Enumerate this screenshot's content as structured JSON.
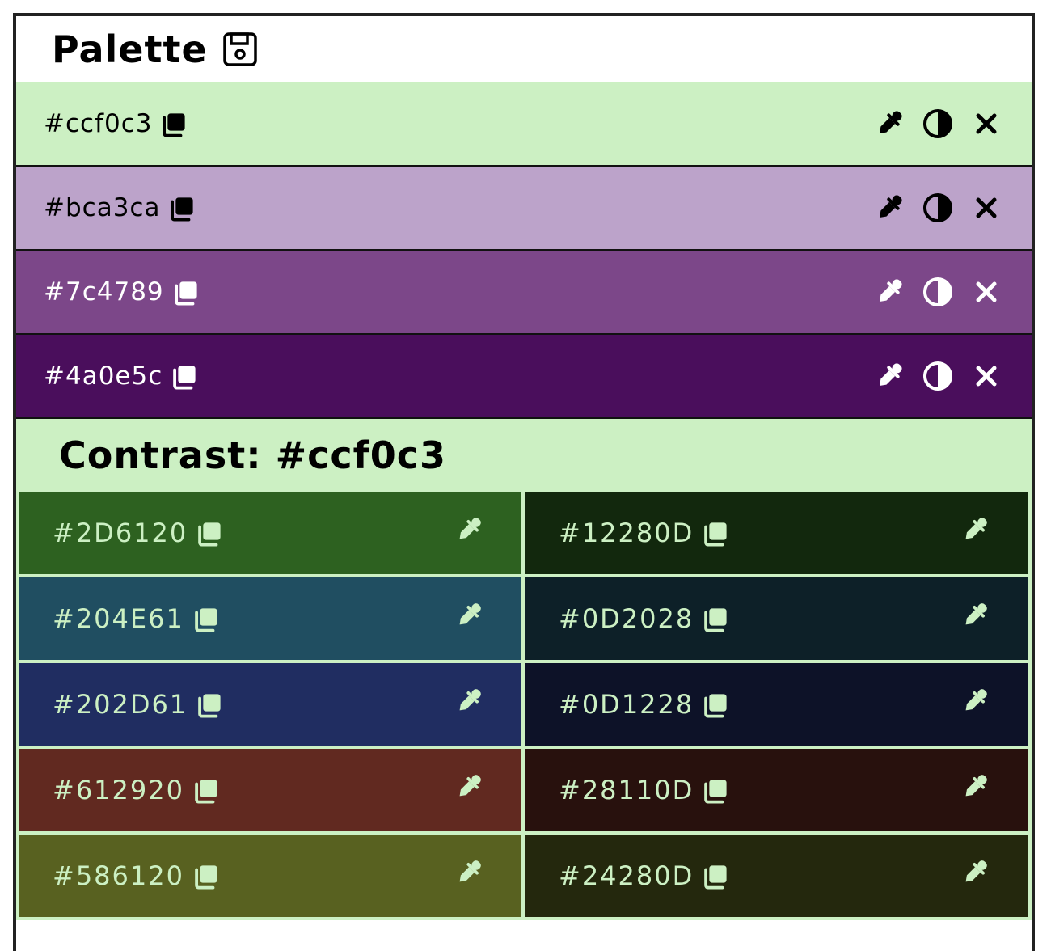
{
  "header": {
    "title": "Palette",
    "save_icon": "floppy-disk-icon"
  },
  "palette": [
    {
      "hex": "#ccf0c3",
      "bg": "#ccf0c3",
      "fg": "#000000"
    },
    {
      "hex": "#bca3ca",
      "bg": "#bca3ca",
      "fg": "#000000"
    },
    {
      "hex": "#7c4789",
      "bg": "#7c4789",
      "fg": "#ffffff"
    },
    {
      "hex": "#4a0e5c",
      "bg": "#4a0e5c",
      "fg": "#ffffff"
    }
  ],
  "row_icons": {
    "copy": "copy-icon",
    "pick": "eyedropper-icon",
    "contrast": "contrast-icon",
    "remove": "close-icon"
  },
  "contrast": {
    "title": "Contrast: #ccf0c3",
    "accent": "#ccf0c3",
    "cells": [
      {
        "hex": "#2D6120",
        "bg": "#2D6120"
      },
      {
        "hex": "#12280D",
        "bg": "#12280D"
      },
      {
        "hex": "#204E61",
        "bg": "#204E61"
      },
      {
        "hex": "#0D2028",
        "bg": "#0D2028"
      },
      {
        "hex": "#202D61",
        "bg": "#202D61"
      },
      {
        "hex": "#0D1228",
        "bg": "#0D1228"
      },
      {
        "hex": "#612920",
        "bg": "#612920"
      },
      {
        "hex": "#28110D",
        "bg": "#28110D"
      },
      {
        "hex": "#586120",
        "bg": "#586120"
      },
      {
        "hex": "#24280D",
        "bg": "#24280D"
      }
    ]
  }
}
